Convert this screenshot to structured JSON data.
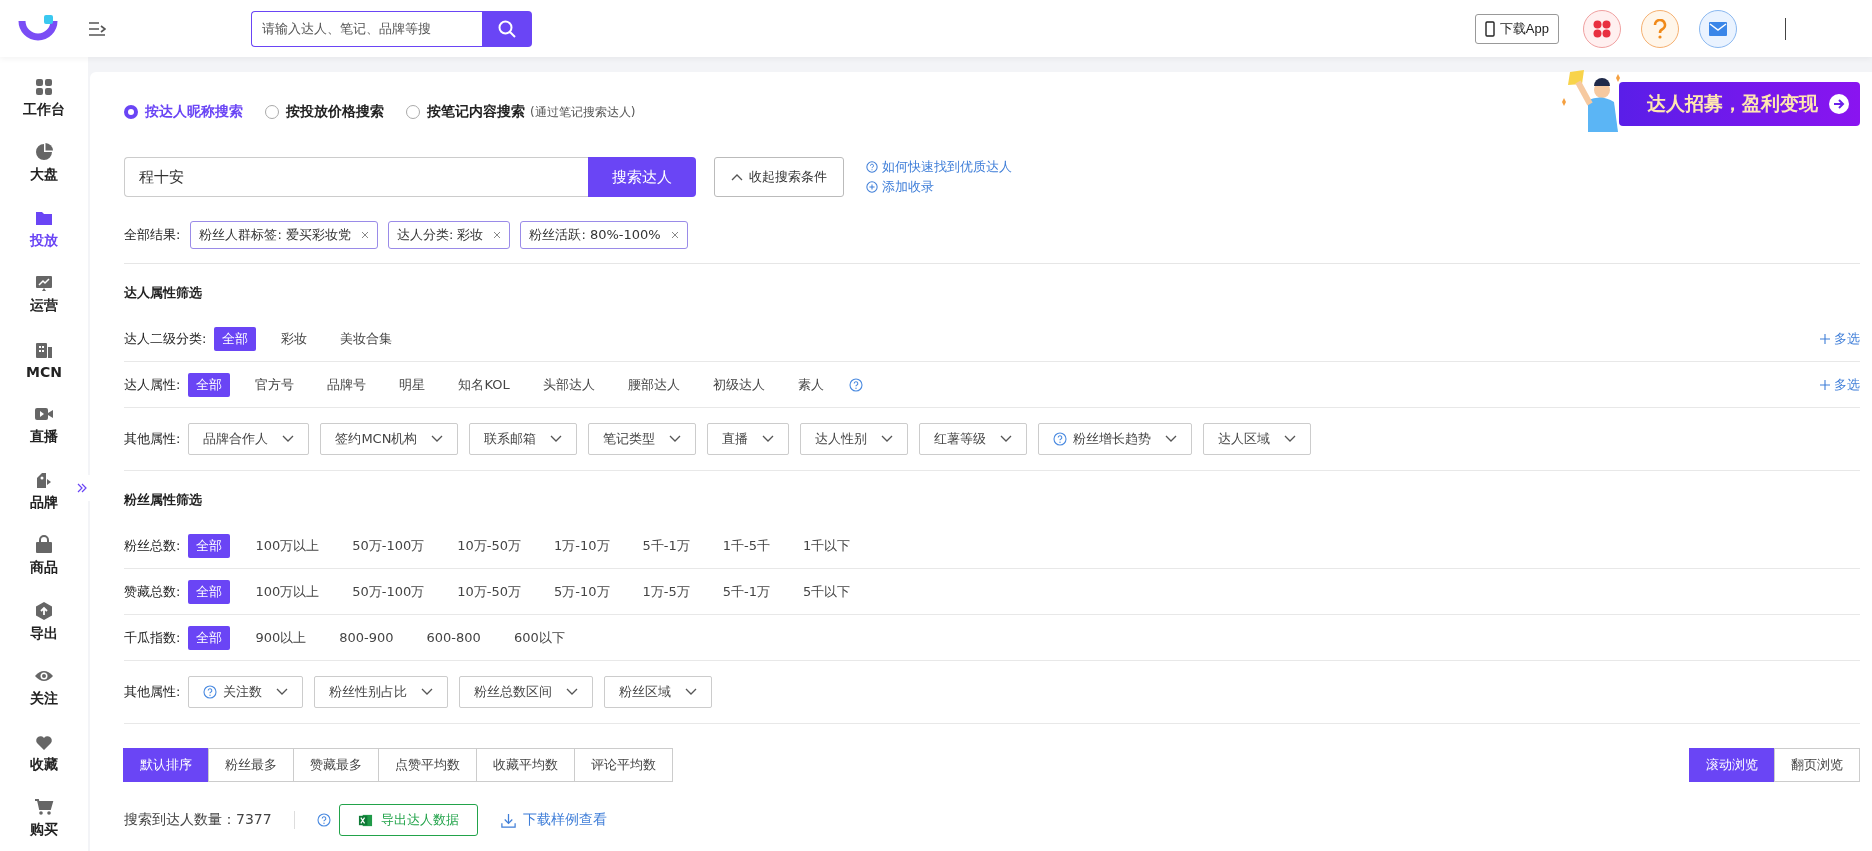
{
  "topbar": {
    "search_placeholder": "请输入达人、笔记、品牌等搜",
    "download_app": "下载App"
  },
  "sidebar": {
    "items": [
      {
        "label": "工作台",
        "selected": false
      },
      {
        "label": "大盘",
        "selected": false
      },
      {
        "label": "投放",
        "selected": true
      },
      {
        "label": "运营",
        "selected": false
      },
      {
        "label": "MCN",
        "selected": false
      },
      {
        "label": "直播",
        "selected": false
      },
      {
        "label": "品牌",
        "selected": false
      },
      {
        "label": "商品",
        "selected": false
      },
      {
        "label": "导出",
        "selected": false
      },
      {
        "label": "关注",
        "selected": false
      },
      {
        "label": "收藏",
        "selected": false
      },
      {
        "label": "购买",
        "selected": false
      }
    ]
  },
  "search_modes": [
    {
      "label": "按达人昵称搜索",
      "selected": true
    },
    {
      "label": "按投放价格搜索",
      "selected": false
    },
    {
      "label": "按笔记内容搜索",
      "selected": false,
      "hint": "(通过笔记搜索达人)"
    }
  ],
  "banner": {
    "text": "达人招募，盈利变现"
  },
  "search": {
    "value": "程十安",
    "button": "搜索达人",
    "collapse": "收起搜索条件",
    "links": [
      "如何快速找到优质达人",
      "添加收录"
    ]
  },
  "result_tags": {
    "label": "全部结果:",
    "tags": [
      "粉丝人群标签: 爱买彩妆党",
      "达人分类: 彩妆",
      "粉丝活跃: 80%-100%"
    ]
  },
  "sections": [
    {
      "title": "达人属性筛选",
      "rows": [
        {
          "kind": "options",
          "label": "达人二级分类:",
          "multi": "多选",
          "help": false,
          "options": [
            {
              "label": "全部",
              "selected": true
            },
            {
              "label": "彩妆",
              "selected": false
            },
            {
              "label": "美妆合集",
              "selected": false
            }
          ]
        },
        {
          "kind": "options",
          "label": "达人属性:",
          "multi": "多选",
          "help": true,
          "options": [
            {
              "label": "全部",
              "selected": true
            },
            {
              "label": "官方号",
              "selected": false
            },
            {
              "label": "品牌号",
              "selected": false
            },
            {
              "label": "明星",
              "selected": false
            },
            {
              "label": "知名KOL",
              "selected": false
            },
            {
              "label": "头部达人",
              "selected": false
            },
            {
              "label": "腰部达人",
              "selected": false
            },
            {
              "label": "初级达人",
              "selected": false
            },
            {
              "label": "素人",
              "selected": false
            }
          ]
        },
        {
          "kind": "dropdowns",
          "label": "其他属性:",
          "dropdowns": [
            {
              "label": "品牌合作人",
              "help": false
            },
            {
              "label": "签约MCN机构",
              "help": false
            },
            {
              "label": "联系邮箱",
              "help": false
            },
            {
              "label": "笔记类型",
              "help": false
            },
            {
              "label": "直播",
              "help": false
            },
            {
              "label": "达人性别",
              "help": false
            },
            {
              "label": "红薯等级",
              "help": false
            },
            {
              "label": "粉丝增长趋势",
              "help": true
            },
            {
              "label": "达人区域",
              "help": false
            }
          ]
        }
      ]
    },
    {
      "title": "粉丝属性筛选",
      "rows": [
        {
          "kind": "options",
          "label": "粉丝总数:",
          "help": false,
          "options": [
            {
              "label": "全部",
              "selected": true
            },
            {
              "label": "100万以上",
              "selected": false
            },
            {
              "label": "50万-100万",
              "selected": false
            },
            {
              "label": "10万-50万",
              "selected": false
            },
            {
              "label": "1万-10万",
              "selected": false
            },
            {
              "label": "5千-1万",
              "selected": false
            },
            {
              "label": "1千-5千",
              "selected": false
            },
            {
              "label": "1千以下",
              "selected": false
            }
          ]
        },
        {
          "kind": "options",
          "label": "赞藏总数:",
          "help": false,
          "options": [
            {
              "label": "全部",
              "selected": true
            },
            {
              "label": "100万以上",
              "selected": false
            },
            {
              "label": "50万-100万",
              "selected": false
            },
            {
              "label": "10万-50万",
              "selected": false
            },
            {
              "label": "5万-10万",
              "selected": false
            },
            {
              "label": "1万-5万",
              "selected": false
            },
            {
              "label": "5千-1万",
              "selected": false
            },
            {
              "label": "5千以下",
              "selected": false
            }
          ]
        },
        {
          "kind": "options",
          "label": "千瓜指数:",
          "help": false,
          "options": [
            {
              "label": "全部",
              "selected": true
            },
            {
              "label": "900以上",
              "selected": false
            },
            {
              "label": "800-900",
              "selected": false
            },
            {
              "label": "600-800",
              "selected": false
            },
            {
              "label": "600以下",
              "selected": false
            }
          ]
        },
        {
          "kind": "dropdowns",
          "label": "其他属性:",
          "dropdowns": [
            {
              "label": "关注数",
              "help": true
            },
            {
              "label": "粉丝性别占比",
              "help": false
            },
            {
              "label": "粉丝总数区间",
              "help": false
            },
            {
              "label": "粉丝区域",
              "help": false
            }
          ]
        }
      ]
    }
  ],
  "sort": {
    "options": [
      {
        "label": "默认排序",
        "selected": true
      },
      {
        "label": "粉丝最多",
        "selected": false
      },
      {
        "label": "赞藏最多",
        "selected": false
      },
      {
        "label": "点赞平均数",
        "selected": false
      },
      {
        "label": "收藏平均数",
        "selected": false
      },
      {
        "label": "评论平均数",
        "selected": false
      }
    ],
    "views": [
      {
        "label": "滚动浏览",
        "selected": true
      },
      {
        "label": "翻页浏览",
        "selected": false
      }
    ]
  },
  "results": {
    "count": "搜索到达人数量：7377",
    "export": "导出达人数据",
    "download": "下载样例查看"
  }
}
